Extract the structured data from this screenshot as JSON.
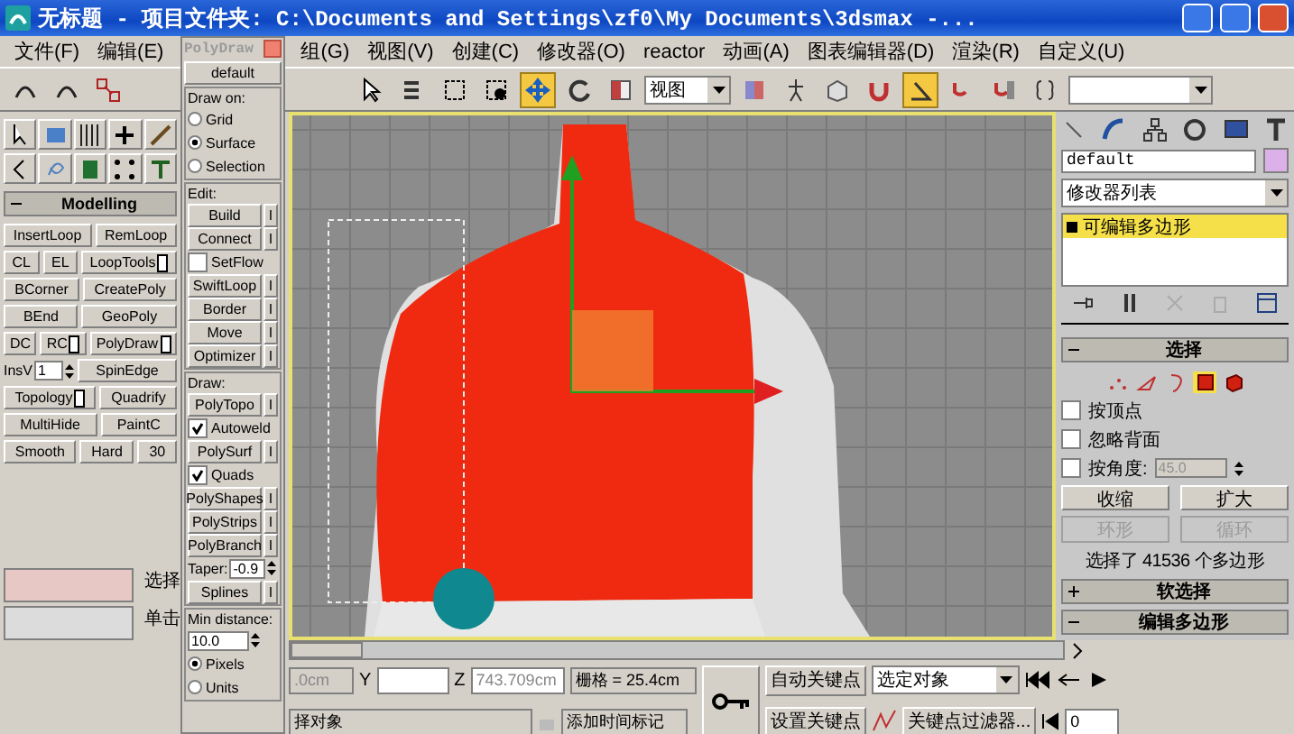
{
  "window": {
    "title": "无标题  - 项目文件夹: C:\\Documents and Settings\\zf0\\My Documents\\3dsmax  -..."
  },
  "menu": [
    "文件(F)",
    "编辑(E)",
    "组(G)",
    "视图(V)",
    "创建(C)",
    "修改器(O)",
    "reactor",
    "动画(A)",
    "图表编辑器(D)",
    "渲染(R)",
    "自定义(U)"
  ],
  "toolbar": {
    "view_dropdown": "视图"
  },
  "modelling": {
    "title": "Modelling",
    "rows": [
      [
        {
          "kind": "button",
          "label": "InsertLoop",
          "options": false
        },
        {
          "kind": "button",
          "label": "RemLoop",
          "options": false
        }
      ],
      [
        {
          "kind": "button",
          "label": "CL",
          "options": false
        },
        {
          "kind": "button",
          "label": "EL",
          "options": false
        },
        {
          "kind": "button",
          "label": "LoopTools",
          "options": true
        }
      ],
      [
        {
          "kind": "button",
          "label": "BCorner",
          "options": false
        },
        {
          "kind": "button",
          "label": "CreatePoly",
          "options": false
        }
      ],
      [
        {
          "kind": "button",
          "label": "BEnd",
          "options": false
        },
        {
          "kind": "button",
          "label": "GeoPoly",
          "options": false
        }
      ],
      [
        {
          "kind": "button",
          "label": "DC",
          "options": false
        },
        {
          "kind": "button",
          "label": "RC",
          "options": true
        },
        {
          "kind": "button",
          "label": "PolyDraw",
          "options": true
        }
      ],
      [
        {
          "kind": "spinner",
          "label": "InsV",
          "value": "1"
        },
        {
          "kind": "button",
          "label": "SpinEdge",
          "options": false
        }
      ],
      [
        {
          "kind": "button",
          "label": "Topology",
          "options": true
        },
        {
          "kind": "button",
          "label": "Quadrify",
          "options": false
        }
      ],
      [
        {
          "kind": "button",
          "label": "MultiHide",
          "options": false
        },
        {
          "kind": "button",
          "label": "PaintC",
          "options": false
        }
      ],
      [
        {
          "kind": "button",
          "label": "Smooth",
          "options": false
        },
        {
          "kind": "button",
          "label": "Hard",
          "options": false
        },
        {
          "kind": "button",
          "label": "30",
          "options": false
        }
      ]
    ]
  },
  "polydraw": {
    "title": "PolyDraw",
    "preset": "default",
    "sections": [
      {
        "title": "Draw on:",
        "items": [
          {
            "kind": "radio",
            "label": "Grid",
            "selected": false
          },
          {
            "kind": "radio",
            "label": "Surface",
            "selected": true
          },
          {
            "kind": "radio",
            "label": "Selection",
            "selected": false
          }
        ]
      },
      {
        "title": "Edit:",
        "items": [
          {
            "kind": "tool",
            "label": "Build",
            "side": "I"
          },
          {
            "kind": "tool",
            "label": "Connect",
            "side": "I"
          },
          {
            "kind": "checkbox",
            "label": "SetFlow",
            "checked": false
          },
          {
            "kind": "tool",
            "label": "SwiftLoop",
            "side": "I"
          },
          {
            "kind": "tool",
            "label": "Border",
            "side": "I"
          },
          {
            "kind": "tool",
            "label": "Move",
            "side": "I"
          },
          {
            "kind": "tool",
            "label": "Optimizer",
            "side": "I"
          }
        ]
      },
      {
        "title": "Draw:",
        "items": [
          {
            "kind": "tool",
            "label": "PolyTopo",
            "side": "I"
          },
          {
            "kind": "checkbox",
            "label": "Autoweld",
            "checked": true
          },
          {
            "kind": "tool",
            "label": "PolySurf",
            "side": "I"
          },
          {
            "kind": "checkbox",
            "label": "Quads",
            "checked": true
          },
          {
            "kind": "tool",
            "label": "PolyShapes",
            "side": "I"
          },
          {
            "kind": "tool",
            "label": "PolyStrips",
            "side": "I"
          },
          {
            "kind": "tool",
            "label": "PolyBranch",
            "side": "I"
          },
          {
            "kind": "spinner",
            "label": "Taper:",
            "value": "-0.9"
          },
          {
            "kind": "tool",
            "label": "Splines",
            "side": "I"
          }
        ]
      },
      {
        "title": "Min distance:",
        "items": [
          {
            "kind": "spinner",
            "value": "10.0"
          },
          {
            "kind": "radio",
            "label": "Pixels",
            "selected": true
          },
          {
            "kind": "radio",
            "label": "Units",
            "selected": false
          }
        ]
      }
    ]
  },
  "left_status": {
    "line_1": "选择",
    "line_2": "单击"
  },
  "command_panel": {
    "object_name": "default",
    "modifier_list": "修改器列表",
    "stack": [
      {
        "label": "可编辑多边形",
        "selected": true
      }
    ],
    "selection": {
      "title": "选择",
      "subobjects": [
        {
          "kind": "vertex",
          "selected": false
        },
        {
          "kind": "edge",
          "selected": false
        },
        {
          "kind": "border",
          "selected": false
        },
        {
          "kind": "polygon",
          "selected": true
        },
        {
          "kind": "element",
          "selected": false
        }
      ],
      "options": [
        {
          "label": "按顶点",
          "checked": false
        },
        {
          "label": "忽略背面",
          "checked": false
        },
        {
          "label": "按角度:",
          "checked": false
        }
      ],
      "angle_value": "45.0",
      "buttons": [
        "收缩",
        "扩大"
      ],
      "loops": [
        {
          "label": "环形",
          "disabled": true
        },
        {
          "label": "循环",
          "disabled": true
        }
      ],
      "summary": "选择了 41536 个多边形"
    },
    "rollouts": [
      {
        "label": "软选择",
        "expanded": false
      },
      {
        "label": "编辑多边形",
        "expanded": true
      }
    ]
  },
  "time_slider": {
    "level": 0
  },
  "status": {
    "x_value": ".0cm",
    "y_label": "Y",
    "z_label": "Z",
    "z_value": "743.709cm",
    "grid": "栅格 = 25.4cm",
    "prompt": "择对象",
    "time_tag": "添加时间标记",
    "auto_key": "自动关键点",
    "set_key": "设置关键点",
    "key_mode": "选定对象",
    "key_filters": "关键点过滤器...",
    "current_frame": "0"
  }
}
